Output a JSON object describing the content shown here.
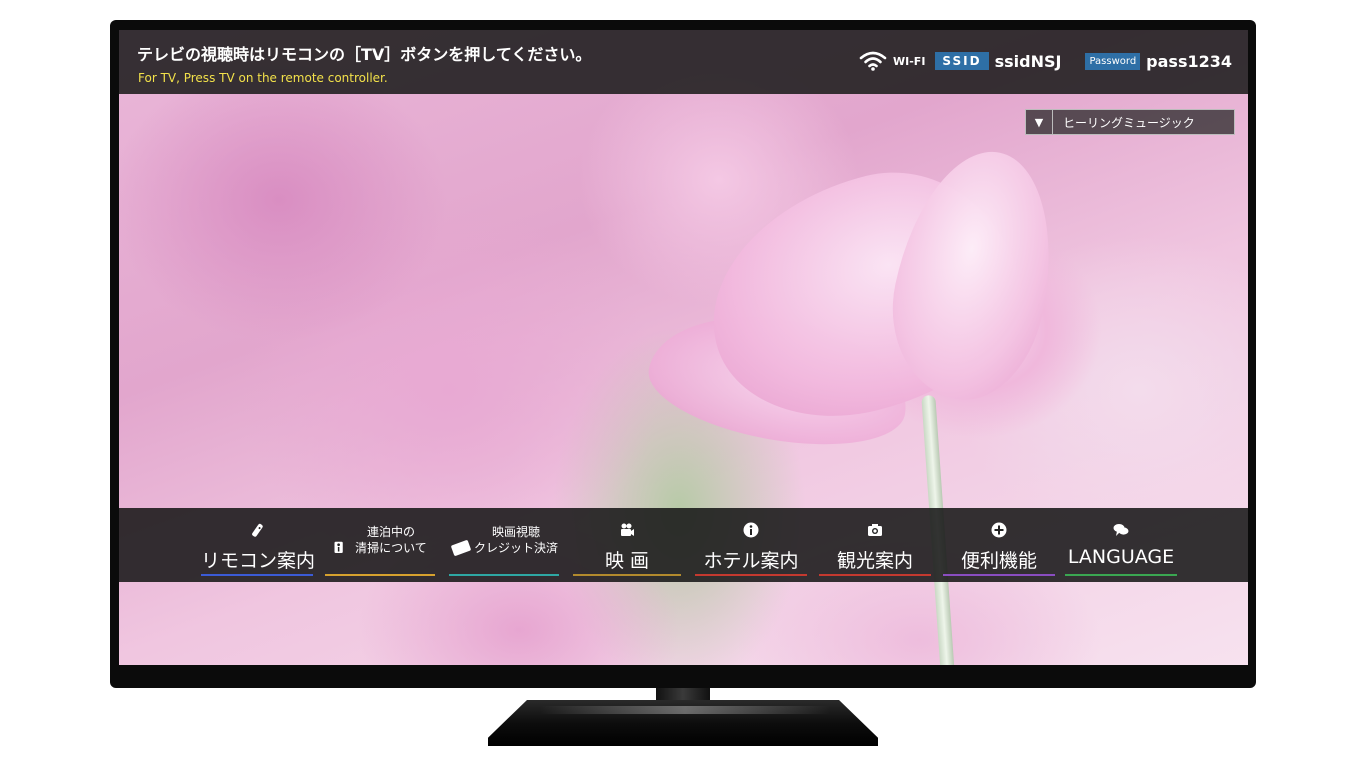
{
  "header": {
    "notice_jp": "テレビの視聴時はリモコンの［TV］ボタンを押してください。",
    "notice_en": "For TV, Press TV on the remote controller.",
    "wifi_label": "WI-FI",
    "ssid_label": "SSID",
    "ssid_value": "ssidNSJ",
    "password_label": "Password",
    "password_value": "pass1234"
  },
  "music": {
    "arrow": "▼",
    "label": "ヒーリングミュージック"
  },
  "menu": {
    "items": [
      {
        "label": "リモコン案内",
        "icon": "remote-icon",
        "color": "#3b5bd6"
      },
      {
        "label_line1": "連泊中の",
        "label_line2": "清掃について",
        "icon": "cleaning-tag-icon",
        "color": "#d6a12e"
      },
      {
        "label_line1": "映画視聴",
        "label_line2": "クレジット決済",
        "icon": "credit-card-icon",
        "color": "#2ea7a3"
      },
      {
        "label": "映 画",
        "icon": "movie-camera-icon",
        "color": "#b28a2d"
      },
      {
        "label": "ホテル案内",
        "icon": "info-icon",
        "color": "#c4392f"
      },
      {
        "label": "観光案内",
        "icon": "camera-icon",
        "color": "#c4392f"
      },
      {
        "label": "便利機能",
        "icon": "plus-circle-icon",
        "color": "#8a4dc0"
      },
      {
        "label": "LANGUAGE",
        "icon": "chat-bubbles-icon",
        "color": "#3aa651"
      }
    ]
  }
}
